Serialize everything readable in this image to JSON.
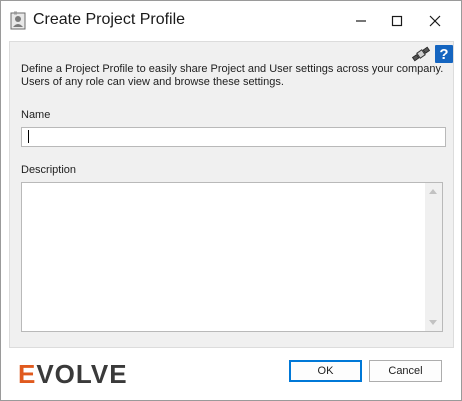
{
  "window": {
    "title": "Create Project Profile",
    "icon": "user-profile-icon",
    "controls": [
      "minimize-icon",
      "maximize-icon",
      "close-icon"
    ]
  },
  "toolbar": {
    "icons": [
      "satellite-icon",
      "help-icon"
    ],
    "help_glyph": "?"
  },
  "intro_text": "Define a Project Profile to easily share Project and User settings across your company. Users of any role can view and browse these settings.",
  "form": {
    "name_label": "Name",
    "name_value": "",
    "description_label": "Description",
    "description_value": ""
  },
  "footer": {
    "logo_text": "EVOLVE",
    "ok_label": "OK",
    "cancel_label": "Cancel"
  },
  "colors": {
    "accent": "#0078d7",
    "help_bg": "#1565c0",
    "logo_orange": "#e05a1e",
    "logo_dark": "#3a3a3a"
  }
}
